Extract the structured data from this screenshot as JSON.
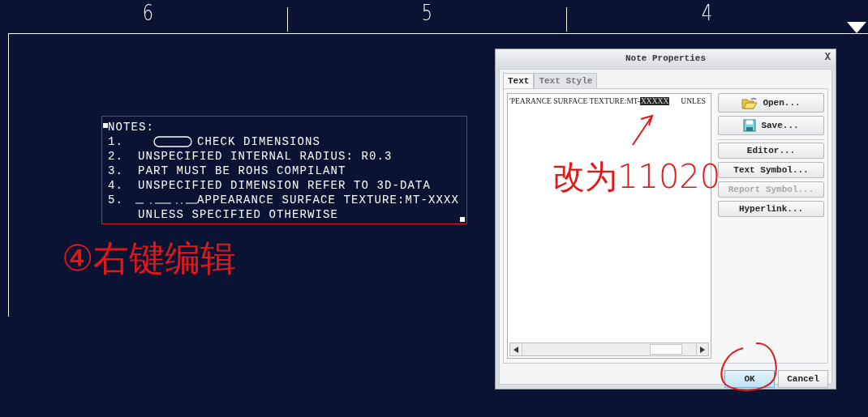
{
  "ruler": {
    "zones": [
      "6",
      "5",
      "4"
    ]
  },
  "note": {
    "lines": [
      {
        "text": "NOTES:",
        "kind": "heading"
      },
      {
        "number": "1.",
        "text": "CHECK DIMENSIONS",
        "kind": "oval"
      },
      {
        "number": "2.",
        "text": "UNSPECIFIED INTERNAL RADIUS: R0.3",
        "kind": "plain"
      },
      {
        "number": "3.",
        "text": "PART MUST BE ROHS COMPILANT",
        "kind": "plain"
      },
      {
        "number": "4.",
        "text": "UNSPECIFIED DIMENSION REFER TO 3D-DATA",
        "kind": "plain"
      },
      {
        "number": "5.",
        "text": "APPEARANCE SURFACE TEXTURE:MT-XXXX",
        "kind": "dashes"
      },
      {
        "text": "UNLESS SPECIFIED OTHERWISE",
        "kind": "plain"
      }
    ]
  },
  "dialog": {
    "title": "Note Properties",
    "close": "X",
    "tabs": [
      {
        "label": "Text",
        "selected": true
      },
      {
        "label": "Text Style",
        "selected": false
      }
    ],
    "editor": {
      "before": "'PEARANCE SURFACE TEXTURE:MT-",
      "selection": "XXXXX",
      "after": "UNLES"
    },
    "buttons": [
      {
        "label": "Open...",
        "kind": "open",
        "disabled": false
      },
      {
        "label": "Save...",
        "kind": "save",
        "disabled": false
      },
      {
        "label": "Editor...",
        "kind": "plain",
        "disabled": false
      },
      {
        "label": "Text Symbol...",
        "kind": "plain",
        "disabled": false
      },
      {
        "label": "Report Symbol...",
        "kind": "plain",
        "disabled": true
      },
      {
        "label": "Hyperlink...",
        "kind": "plain",
        "disabled": false
      }
    ],
    "footer": [
      {
        "label": "OK",
        "selected": true
      },
      {
        "label": "Cancel",
        "selected": false
      }
    ]
  },
  "annotations": [
    {
      "text": "④右键编辑",
      "kind": "step"
    },
    {
      "text": "改为11020",
      "kind": "change"
    }
  ]
}
